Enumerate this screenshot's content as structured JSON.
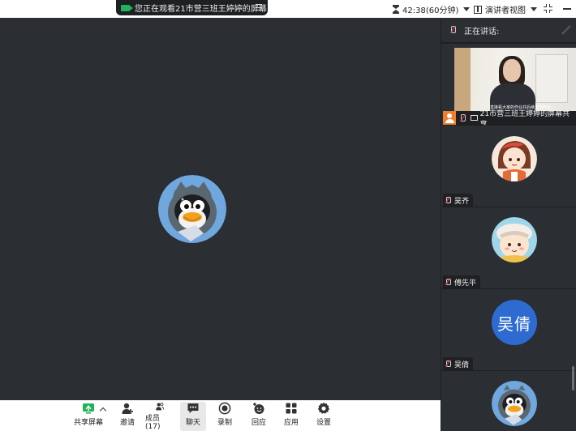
{
  "top_bar": {
    "share_banner_text": "您正在观看21市营三班王婷婷的屏幕",
    "timer_text": "42:38(60分钟)",
    "view_mode_label": "演讲者视图"
  },
  "panel": {
    "speaking_label": "正在讲话:",
    "presenter_tile": {
      "name": "21市营三班王婷婷的屏幕共享",
      "video_subtitle": "直接看大家的作业并后续发布作业"
    },
    "participants": [
      {
        "name": "吴齐",
        "avatar": "cartoon-girl-avatar"
      },
      {
        "name": "傅先平",
        "avatar": "cartoon-bear-avatar"
      },
      {
        "name": "吴倩",
        "avatar_text": "吴倩",
        "avatar_color": "#2d6bd1"
      },
      {
        "name": "",
        "avatar": "penguin-cat-avatar"
      }
    ]
  },
  "toolbar": {
    "share_screen": "共享屏幕",
    "invite": "邀请",
    "members": "成员(17)",
    "chat": "聊天",
    "record": "录制",
    "reactions": "回应",
    "apps": "应用",
    "settings": "设置"
  },
  "colors": {
    "accent_green": "#1fb35a",
    "presenter_badge": "#ef7d2b",
    "stage_bg": "#2b2e32"
  }
}
